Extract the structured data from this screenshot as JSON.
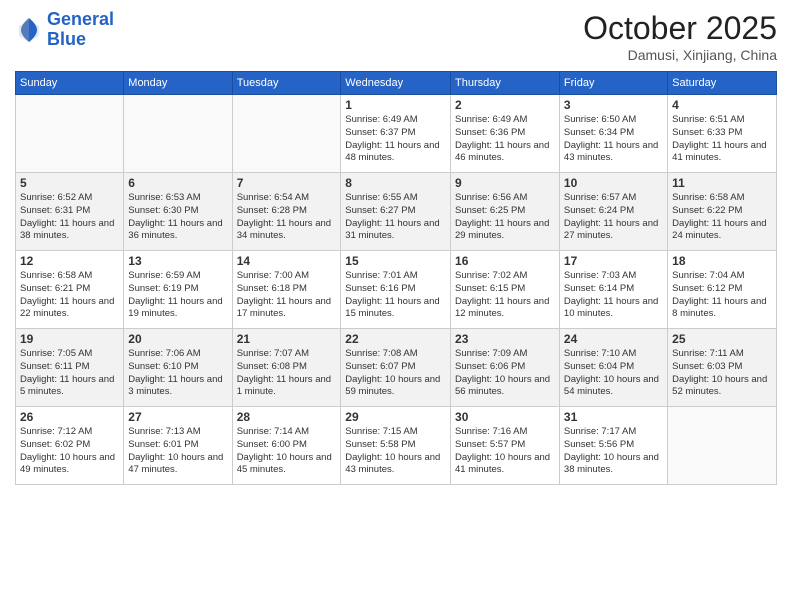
{
  "header": {
    "logo_line1": "General",
    "logo_line2": "Blue",
    "month": "October 2025",
    "location": "Damusi, Xinjiang, China"
  },
  "weekdays": [
    "Sunday",
    "Monday",
    "Tuesday",
    "Wednesday",
    "Thursday",
    "Friday",
    "Saturday"
  ],
  "weeks": [
    [
      {
        "day": "",
        "empty": true
      },
      {
        "day": "",
        "empty": true
      },
      {
        "day": "",
        "empty": true
      },
      {
        "day": "1",
        "sunrise": "6:49 AM",
        "sunset": "6:37 PM",
        "daylight": "11 hours and 48 minutes."
      },
      {
        "day": "2",
        "sunrise": "6:49 AM",
        "sunset": "6:36 PM",
        "daylight": "11 hours and 46 minutes."
      },
      {
        "day": "3",
        "sunrise": "6:50 AM",
        "sunset": "6:34 PM",
        "daylight": "11 hours and 43 minutes."
      },
      {
        "day": "4",
        "sunrise": "6:51 AM",
        "sunset": "6:33 PM",
        "daylight": "11 hours and 41 minutes."
      }
    ],
    [
      {
        "day": "5",
        "sunrise": "6:52 AM",
        "sunset": "6:31 PM",
        "daylight": "11 hours and 38 minutes."
      },
      {
        "day": "6",
        "sunrise": "6:53 AM",
        "sunset": "6:30 PM",
        "daylight": "11 hours and 36 minutes."
      },
      {
        "day": "7",
        "sunrise": "6:54 AM",
        "sunset": "6:28 PM",
        "daylight": "11 hours and 34 minutes."
      },
      {
        "day": "8",
        "sunrise": "6:55 AM",
        "sunset": "6:27 PM",
        "daylight": "11 hours and 31 minutes."
      },
      {
        "day": "9",
        "sunrise": "6:56 AM",
        "sunset": "6:25 PM",
        "daylight": "11 hours and 29 minutes."
      },
      {
        "day": "10",
        "sunrise": "6:57 AM",
        "sunset": "6:24 PM",
        "daylight": "11 hours and 27 minutes."
      },
      {
        "day": "11",
        "sunrise": "6:58 AM",
        "sunset": "6:22 PM",
        "daylight": "11 hours and 24 minutes."
      }
    ],
    [
      {
        "day": "12",
        "sunrise": "6:58 AM",
        "sunset": "6:21 PM",
        "daylight": "11 hours and 22 minutes."
      },
      {
        "day": "13",
        "sunrise": "6:59 AM",
        "sunset": "6:19 PM",
        "daylight": "11 hours and 19 minutes."
      },
      {
        "day": "14",
        "sunrise": "7:00 AM",
        "sunset": "6:18 PM",
        "daylight": "11 hours and 17 minutes."
      },
      {
        "day": "15",
        "sunrise": "7:01 AM",
        "sunset": "6:16 PM",
        "daylight": "11 hours and 15 minutes."
      },
      {
        "day": "16",
        "sunrise": "7:02 AM",
        "sunset": "6:15 PM",
        "daylight": "11 hours and 12 minutes."
      },
      {
        "day": "17",
        "sunrise": "7:03 AM",
        "sunset": "6:14 PM",
        "daylight": "11 hours and 10 minutes."
      },
      {
        "day": "18",
        "sunrise": "7:04 AM",
        "sunset": "6:12 PM",
        "daylight": "11 hours and 8 minutes."
      }
    ],
    [
      {
        "day": "19",
        "sunrise": "7:05 AM",
        "sunset": "6:11 PM",
        "daylight": "11 hours and 5 minutes."
      },
      {
        "day": "20",
        "sunrise": "7:06 AM",
        "sunset": "6:10 PM",
        "daylight": "11 hours and 3 minutes."
      },
      {
        "day": "21",
        "sunrise": "7:07 AM",
        "sunset": "6:08 PM",
        "daylight": "11 hours and 1 minute."
      },
      {
        "day": "22",
        "sunrise": "7:08 AM",
        "sunset": "6:07 PM",
        "daylight": "10 hours and 59 minutes."
      },
      {
        "day": "23",
        "sunrise": "7:09 AM",
        "sunset": "6:06 PM",
        "daylight": "10 hours and 56 minutes."
      },
      {
        "day": "24",
        "sunrise": "7:10 AM",
        "sunset": "6:04 PM",
        "daylight": "10 hours and 54 minutes."
      },
      {
        "day": "25",
        "sunrise": "7:11 AM",
        "sunset": "6:03 PM",
        "daylight": "10 hours and 52 minutes."
      }
    ],
    [
      {
        "day": "26",
        "sunrise": "7:12 AM",
        "sunset": "6:02 PM",
        "daylight": "10 hours and 49 minutes."
      },
      {
        "day": "27",
        "sunrise": "7:13 AM",
        "sunset": "6:01 PM",
        "daylight": "10 hours and 47 minutes."
      },
      {
        "day": "28",
        "sunrise": "7:14 AM",
        "sunset": "6:00 PM",
        "daylight": "10 hours and 45 minutes."
      },
      {
        "day": "29",
        "sunrise": "7:15 AM",
        "sunset": "5:58 PM",
        "daylight": "10 hours and 43 minutes."
      },
      {
        "day": "30",
        "sunrise": "7:16 AM",
        "sunset": "5:57 PM",
        "daylight": "10 hours and 41 minutes."
      },
      {
        "day": "31",
        "sunrise": "7:17 AM",
        "sunset": "5:56 PM",
        "daylight": "10 hours and 38 minutes."
      },
      {
        "day": "",
        "empty": true
      }
    ]
  ]
}
